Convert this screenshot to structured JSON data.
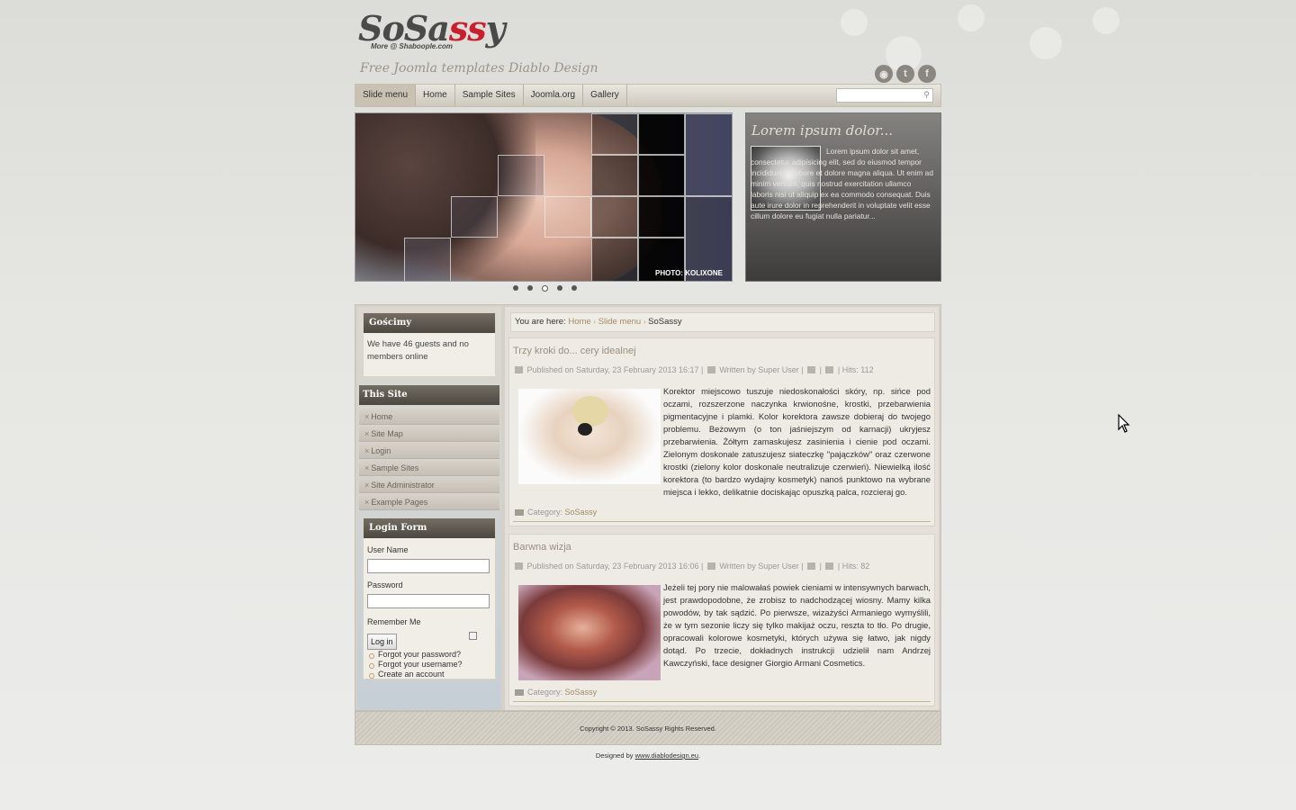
{
  "site": {
    "logo_text_a": "SoSa",
    "logo_text_b": "ss",
    "logo_text_c": "y",
    "logo_sub": "More @ Shaboople.com",
    "tagline": "Free Joomla templates Diablo Design"
  },
  "social": {
    "rss_icon": "rss-icon",
    "twitter_icon": "twitter-icon",
    "facebook_icon": "facebook-icon"
  },
  "nav": {
    "items": [
      {
        "label": "Slide menu",
        "active": true
      },
      {
        "label": "Home"
      },
      {
        "label": "Sample Sites"
      },
      {
        "label": "Joomla.org"
      },
      {
        "label": "Gallery"
      }
    ],
    "search_placeholder": ""
  },
  "slider": {
    "credit": "PHOTO: KOLIXONE",
    "dots": 5,
    "active_dot": 3
  },
  "featured": {
    "title": "Lorem ipsum dolor...",
    "text": "Lorem ipsum dolor sit amet, consectetur adipisicing elit, sed do eiusmod tempor incididunt ut labore et dolore magna aliqua. Ut enim ad minim veniam, quis nostrud exercitation ullamco laboris nisi ut aliquip ex ea commodo consequat. Duis aute irure dolor in reprehenderit in voluptate velit esse cillum dolore eu fugiat nulla pariatur..."
  },
  "sidebar": {
    "guests": {
      "title": "Gościmy",
      "text": "We have 46 guests and no members online"
    },
    "this_site": {
      "title": "This Site",
      "items": [
        "Home",
        "Site Map",
        "Login",
        "Sample Sites",
        "Site Administrator",
        "Example Pages"
      ]
    },
    "login": {
      "title": "Login Form",
      "username_label": "User Name",
      "password_label": "Password",
      "remember_label": "Remember Me",
      "login_button": "Log in",
      "links": [
        "Forgot your password?",
        "Forgot your username?",
        "Create an account"
      ]
    }
  },
  "breadcrumb": {
    "prefix": "You are here:",
    "items": [
      "Home",
      "Slide menu",
      "SoSassy"
    ]
  },
  "articles": [
    {
      "title": "Trzy kroki do... cery idealnej",
      "meta_published": "Published on Saturday, 23 February 2013 16:17",
      "meta_author": "Written by Super User",
      "meta_hits": "Hits: 112",
      "text": "Korektor miejscowo tuszuje niedoskonałości skóry, np. sińce pod oczami, rozszerzone naczynka krwionośne, krostki, przebarwienia pigmentacyjne i plamki. Kolor korektora zawsze dobieraj do twojego problemu. Beżowym (o ton jaśniejszym od karnacji) ukryjesz przebarwienia. Żółtym zamaskujesz zasinienia i cienie pod oczami. Zielonym doskonale zatuszujesz siateczkę \"pajączków\" oraz czerwone krostki (zielony kolor doskonale neutralizuje czerwień). Niewielką ilość korektora (to bardzo wydajny kosmetyk) nanoś punktowo na wybrane miejsca i lekko, delikatnie dociskając opuszką palca, rozcieraj go.",
      "category_label": "Category:",
      "category": "SoSassy"
    },
    {
      "title": "Barwna wizja",
      "meta_published": "Published on Saturday, 23 February 2013 16:06",
      "meta_author": "Written by Super User",
      "meta_hits": "Hits: 82",
      "text": "Jeżeli tej pory nie malowałaś powiek cieniami w intensywnych barwach, jest prawdopodobne, że zrobisz to nadchodzącej wiosny. Mamy kilka powodów, by tak sądzić. Po pierwsze, wizażyści Armaniego wymyślili, że w tym sezonie liczy się tylko makijaż oczu, reszta to tło. Po drugie, opracowali kolorowe kosmetyki, których używa się łatwo, jak nigdy dotąd. Po trzecie, dokładnych instrukcji udzielił nam Andrzej Kawczyński, face designer Giorgio Armani Cosmetics.",
      "category_label": "Category:",
      "category": "SoSassy"
    }
  ],
  "footer": {
    "copyright": "Copyright © 2013. SoSassy  Rights Reserved.",
    "designed_prefix": "Designed by",
    "designed_link": "www.diablodesign.eu",
    "designed_suffix": "."
  }
}
